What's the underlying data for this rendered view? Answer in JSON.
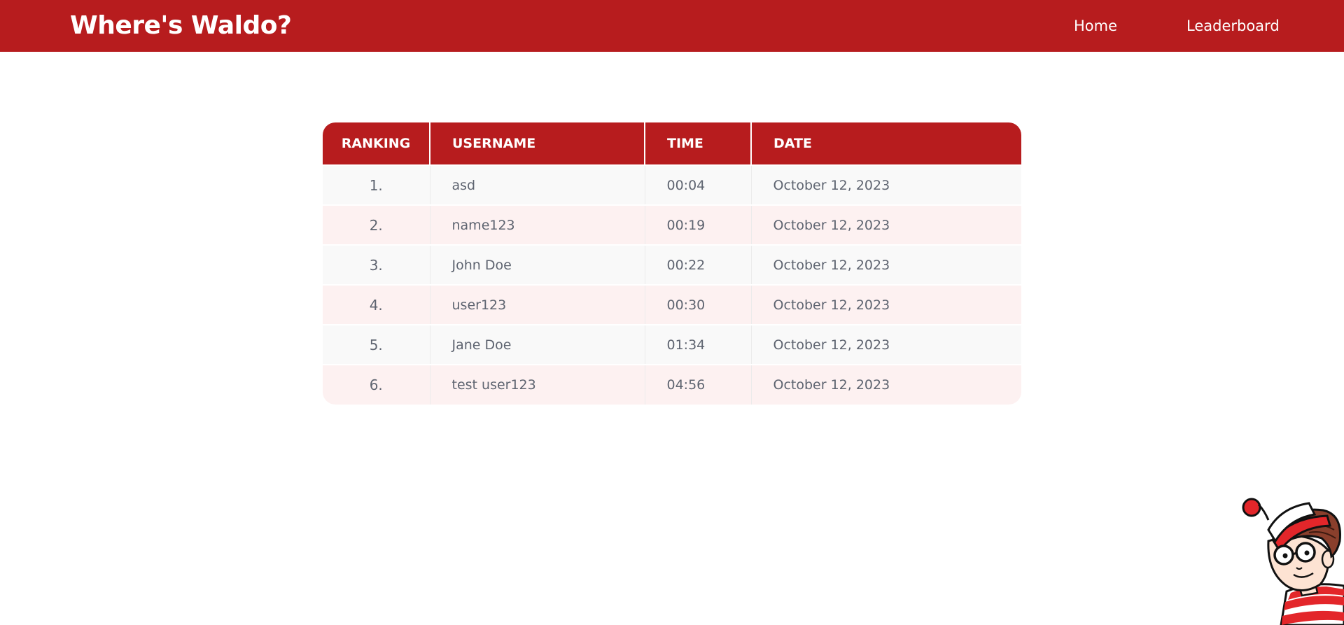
{
  "header": {
    "brand": "Where's Waldo?",
    "nav": [
      {
        "label": "Home"
      },
      {
        "label": "Leaderboard"
      }
    ]
  },
  "leaderboard": {
    "columns": [
      "RANKING",
      "USERNAME",
      "TIME",
      "DATE"
    ],
    "rows": [
      {
        "rank": "1.",
        "username": "asd",
        "time": "00:04",
        "date": "October 12, 2023"
      },
      {
        "rank": "2.",
        "username": "name123",
        "time": "00:19",
        "date": "October 12, 2023"
      },
      {
        "rank": "3.",
        "username": "John Doe",
        "time": "00:22",
        "date": "October 12, 2023"
      },
      {
        "rank": "4.",
        "username": "user123",
        "time": "00:30",
        "date": "October 12, 2023"
      },
      {
        "rank": "5.",
        "username": "Jane Doe",
        "time": "01:34",
        "date": "October 12, 2023"
      },
      {
        "rank": "6.",
        "username": "test user123",
        "time": "04:56",
        "date": "October 12, 2023"
      }
    ]
  },
  "colors": {
    "brand_red": "#b71c1e",
    "row_light": "#f9f9f9",
    "row_pink": "#fdf1f1",
    "text_gray": "#5e6470"
  },
  "decoration": {
    "mascot": "waldo-mascot-icon"
  }
}
